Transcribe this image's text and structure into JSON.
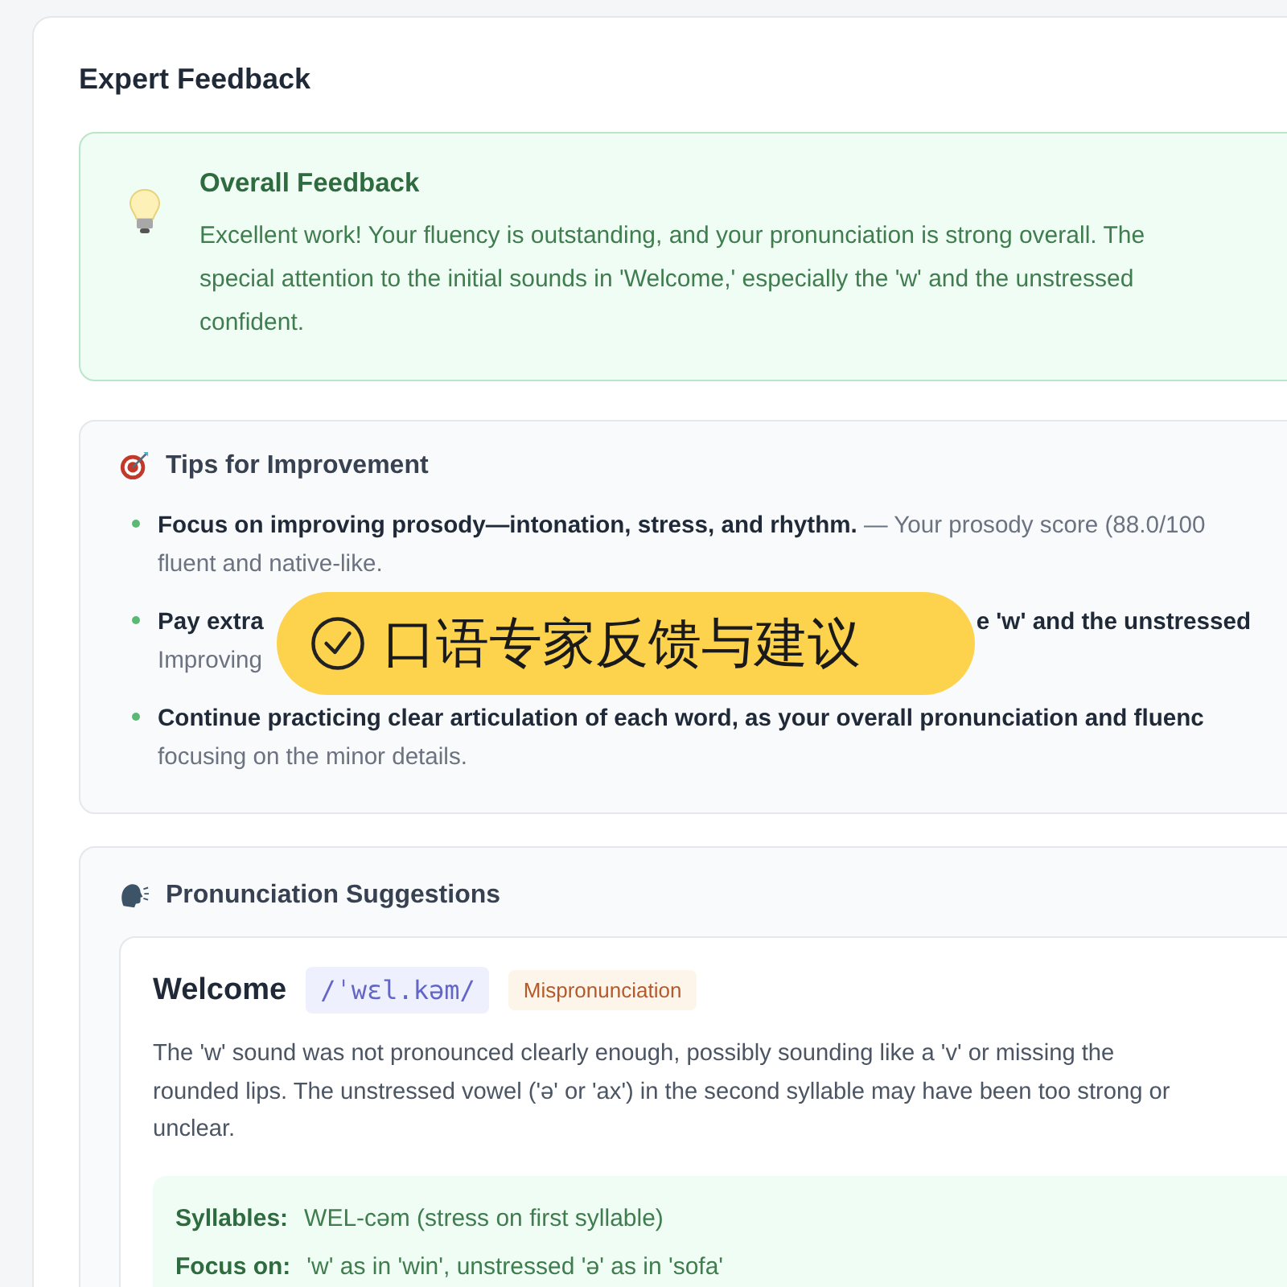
{
  "title": "Expert Feedback",
  "overall": {
    "title": "Overall Feedback",
    "lines": [
      "Excellent work! Your fluency is outstanding, and your pronunciation is strong overall. The",
      "special attention to the initial sounds in 'Welcome,' especially the 'w' and the unstressed",
      "confident."
    ]
  },
  "tips": {
    "title": "Tips for Improvement",
    "items": [
      {
        "lines": [
          [
            {
              "text": "Focus on improving prosody—intonation, stress, and rhythm.",
              "bold": true
            },
            {
              "text": " — Your prosody score (88.0/100",
              "bold": false
            }
          ],
          [
            {
              "text": "fluent and native-like.",
              "bold": false
            }
          ]
        ]
      },
      {
        "lines": [
          [
            {
              "text": "Pay extra",
              "bold": true
            },
            {
              "text": "e 'w' and the unstressed",
              "bold": true,
              "after_badge": true
            }
          ],
          [
            {
              "text": "Improving",
              "bold": false
            }
          ]
        ]
      },
      {
        "lines": [
          [
            {
              "text": "Continue practicing clear articulation of each word, as your overall pronunciation and fluenc",
              "bold": true
            }
          ],
          [
            {
              "text": "focusing on the minor details.",
              "bold": false
            }
          ]
        ]
      }
    ]
  },
  "badge": {
    "text": "口语专家反馈与建议"
  },
  "pronunciation": {
    "title": "Pronunciation Suggestions",
    "words": [
      {
        "word": "Welcome",
        "ipa": "/ˈwɛl.kəm/",
        "tag": "Mispronunciation",
        "lines": [
          "The 'w' sound was not pronounced clearly enough, possibly sounding like a 'v' or missing the",
          "rounded lips. The unstressed vowel ('ə' or 'ax') in the second syllable may have been too strong or",
          "unclear."
        ],
        "details": [
          {
            "label": "Syllables:",
            "value": "WEL-cəm (stress on first syllable)"
          },
          {
            "label": "Focus on:",
            "value": "'w' as in 'win', unstressed 'ə' as in 'sofa'"
          }
        ]
      }
    ]
  }
}
